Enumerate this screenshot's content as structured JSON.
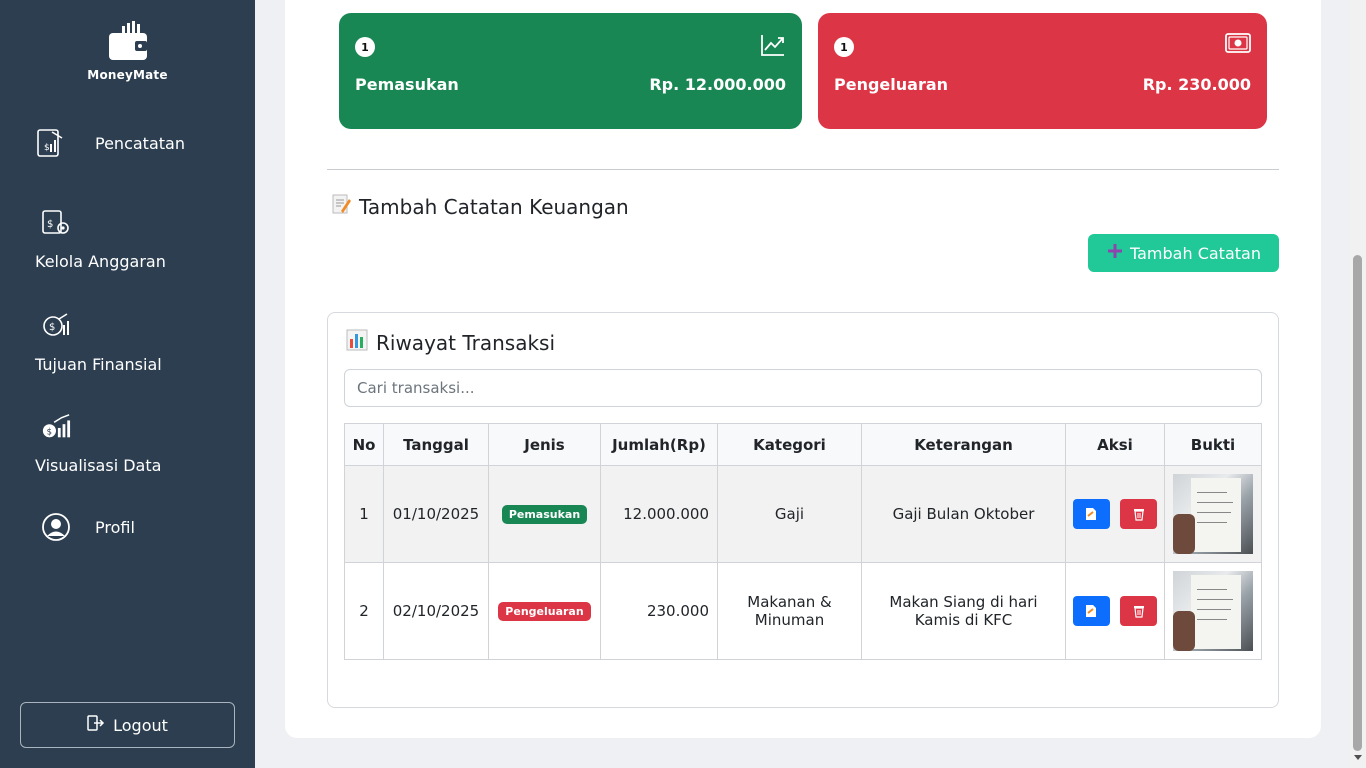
{
  "sidebar": {
    "brand": "MoneyMate",
    "items": [
      {
        "label": "Pencatatan",
        "icon": "ledger-icon"
      },
      {
        "label": "Kelola Anggaran",
        "icon": "budget-icon"
      },
      {
        "label": "Tujuan Finansial",
        "icon": "target-icon"
      },
      {
        "label": "Visualisasi Data",
        "icon": "chart-icon"
      },
      {
        "label": "Profil",
        "icon": "user-icon"
      }
    ],
    "logout_label": "Logout"
  },
  "stats": {
    "income": {
      "count": "1",
      "label": "Pemasukan",
      "value": "Rp. 12.000.000",
      "color": "#198754"
    },
    "expense": {
      "count": "1",
      "label": "Pengeluaran",
      "value": "Rp. 230.000",
      "color": "#dc3545"
    }
  },
  "add_section": {
    "title": "Tambah Catatan Keuangan",
    "button_label": "Tambah Catatan"
  },
  "history": {
    "title": "Riwayat Transaksi",
    "search_placeholder": "Cari transaksi...",
    "columns": [
      "No",
      "Tanggal",
      "Jenis",
      "Jumlah(Rp)",
      "Kategori",
      "Keterangan",
      "Aksi",
      "Bukti"
    ],
    "rows": [
      {
        "no": "1",
        "date": "01/10/2025",
        "type": "Pemasukan",
        "amount": "12.000.000",
        "category": "Gaji",
        "note": "Gaji Bulan Oktober"
      },
      {
        "no": "2",
        "date": "02/10/2025",
        "type": "Pengeluaran",
        "amount": "230.000",
        "category": "Makanan & Minuman",
        "note": "Makan Siang di hari Kamis di KFC"
      }
    ]
  }
}
